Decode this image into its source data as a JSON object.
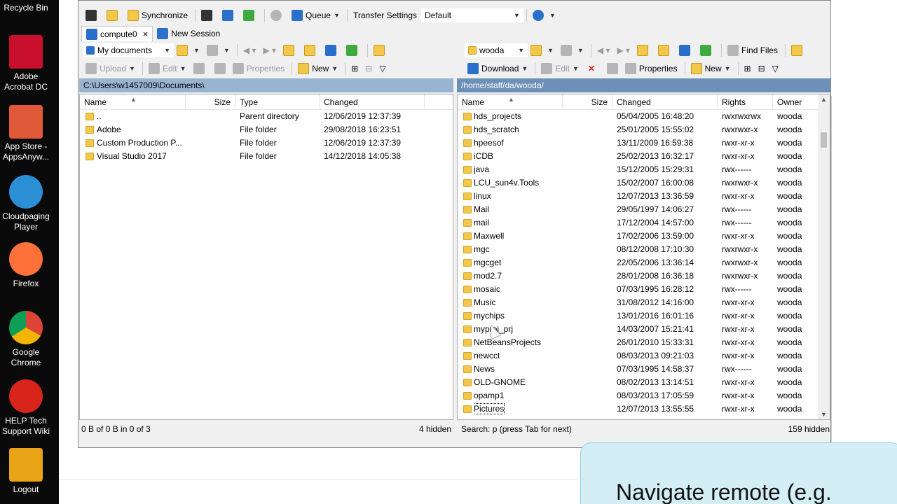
{
  "desktop": {
    "items": [
      {
        "label": "Recycle Bin",
        "icon": "recycle-bin-icon",
        "color": "#4a4a4a"
      },
      {
        "label": "Adobe Acrobat DC",
        "icon": "acrobat-icon",
        "color": "#c8102e"
      },
      {
        "label": "App Store - AppsAnyw...",
        "icon": "app-store-icon",
        "color": "#e05a3a"
      },
      {
        "label": "Cloudpaging Player",
        "icon": "cloud-icon",
        "color": "#2b8fd6"
      },
      {
        "label": "Firefox",
        "icon": "firefox-icon",
        "color": "#ff7139"
      },
      {
        "label": "Google Chrome",
        "icon": "chrome-icon",
        "color": "#4285f4"
      },
      {
        "label": "HELP Tech Support Wiki",
        "icon": "help-icon",
        "color": "#d9241b"
      },
      {
        "label": "Logout",
        "icon": "key-icon",
        "color": "#e8a317"
      }
    ]
  },
  "toolbar_top": {
    "synchronize": "Synchronize",
    "queue": "Queue",
    "transfer_settings_label": "Transfer Settings",
    "transfer_settings_value": "Default"
  },
  "tabs": [
    {
      "label": "compute0",
      "close": "×"
    },
    {
      "label": "New Session"
    }
  ],
  "left": {
    "location": "My documents",
    "actions": {
      "upload": "Upload",
      "edit": "Edit",
      "properties": "Properties",
      "new": "New"
    },
    "path": "C:\\Users\\w1457009\\Documents\\",
    "columns": {
      "name": "Name",
      "size": "Size",
      "type": "Type",
      "changed": "Changed"
    },
    "rows": [
      {
        "name": "..",
        "size": "",
        "type": "Parent directory",
        "changed": "12/06/2019  12:37:39"
      },
      {
        "name": "Adobe",
        "size": "",
        "type": "File folder",
        "changed": "29/08/2018  16:23:51"
      },
      {
        "name": "Custom Production P...",
        "size": "",
        "type": "File folder",
        "changed": "12/06/2019  12:37:39"
      },
      {
        "name": "Visual Studio 2017",
        "size": "",
        "type": "File folder",
        "changed": "14/12/2018  14:05:38"
      }
    ],
    "status_left": "0 B of 0 B in 0 of 3",
    "status_right": "4 hidden"
  },
  "right": {
    "location": "wooda",
    "find_files": "Find Files",
    "actions": {
      "download": "Download",
      "edit": "Edit",
      "properties": "Properties",
      "new": "New"
    },
    "path": "/home/staff/da/wooda/",
    "columns": {
      "name": "Name",
      "size": "Size",
      "changed": "Changed",
      "rights": "Rights",
      "owner": "Owner"
    },
    "rows": [
      {
        "name": "hds_projects",
        "changed": "05/04/2005 16:48:20",
        "rights": "rwxrwxrwx",
        "owner": "wooda"
      },
      {
        "name": "hds_scratch",
        "changed": "25/01/2005 15:55:02",
        "rights": "rwxrwxr-x",
        "owner": "wooda"
      },
      {
        "name": "hpeesof",
        "changed": "13/11/2009 16:59:38",
        "rights": "rwxr-xr-x",
        "owner": "wooda"
      },
      {
        "name": "iCDB",
        "changed": "25/02/2013 16:32:17",
        "rights": "rwxr-xr-x",
        "owner": "wooda"
      },
      {
        "name": "java",
        "changed": "15/12/2005 15:29:31",
        "rights": "rwx------",
        "owner": "wooda"
      },
      {
        "name": "LCU_sun4v.Tools",
        "changed": "15/02/2007 16:00:08",
        "rights": "rwxrwxr-x",
        "owner": "wooda"
      },
      {
        "name": "linux",
        "changed": "12/07/2013 13:36:59",
        "rights": "rwxr-xr-x",
        "owner": "wooda"
      },
      {
        "name": "Mail",
        "changed": "29/05/1997 14:06:27",
        "rights": "rwx------",
        "owner": "wooda"
      },
      {
        "name": "mail",
        "changed": "17/12/2004 14:57:00",
        "rights": "rwx------",
        "owner": "wooda"
      },
      {
        "name": "Maxwell",
        "changed": "17/02/2006 13:59:00",
        "rights": "rwxr-xr-x",
        "owner": "wooda"
      },
      {
        "name": "mgc",
        "changed": "08/12/2008 17:10:30",
        "rights": "rwxrwxr-x",
        "owner": "wooda"
      },
      {
        "name": "mgcget",
        "changed": "22/05/2006 13:36:14",
        "rights": "rwxrwxr-x",
        "owner": "wooda"
      },
      {
        "name": "mod2.7",
        "changed": "28/01/2008 16:36:18",
        "rights": "rwxrwxr-x",
        "owner": "wooda"
      },
      {
        "name": "mosaic",
        "changed": "07/03/1995 16:28:12",
        "rights": "rwx------",
        "owner": "wooda"
      },
      {
        "name": "Music",
        "changed": "31/08/2012 14:16:00",
        "rights": "rwxr-xr-x",
        "owner": "wooda"
      },
      {
        "name": "mychips",
        "changed": "13/01/2016 16:01:16",
        "rights": "rwxr-xr-x",
        "owner": "wooda"
      },
      {
        "name": "myproj_prj",
        "changed": "14/03/2007 15:21:41",
        "rights": "rwxr-xr-x",
        "owner": "wooda"
      },
      {
        "name": "NetBeansProjects",
        "changed": "26/01/2010 15:33:31",
        "rights": "rwxr-xr-x",
        "owner": "wooda"
      },
      {
        "name": "newcct",
        "changed": "08/03/2013 09:21:03",
        "rights": "rwxr-xr-x",
        "owner": "wooda"
      },
      {
        "name": "News",
        "changed": "07/03/1995 14:58:37",
        "rights": "rwx------",
        "owner": "wooda"
      },
      {
        "name": "OLD-GNOME",
        "changed": "08/02/2013 13:14:51",
        "rights": "rwxr-xr-x",
        "owner": "wooda"
      },
      {
        "name": "opamp1",
        "changed": "08/03/2013 17:05:59",
        "rights": "rwxr-xr-x",
        "owner": "wooda"
      },
      {
        "name": "Pictures",
        "changed": "12/07/2013 13:55:55",
        "rights": "rwxr-xr-x",
        "owner": "wooda"
      }
    ],
    "status_left": "Search: p (press Tab for next)",
    "status_right": "159 hidden"
  },
  "caption": "Navigate remote (e.g."
}
